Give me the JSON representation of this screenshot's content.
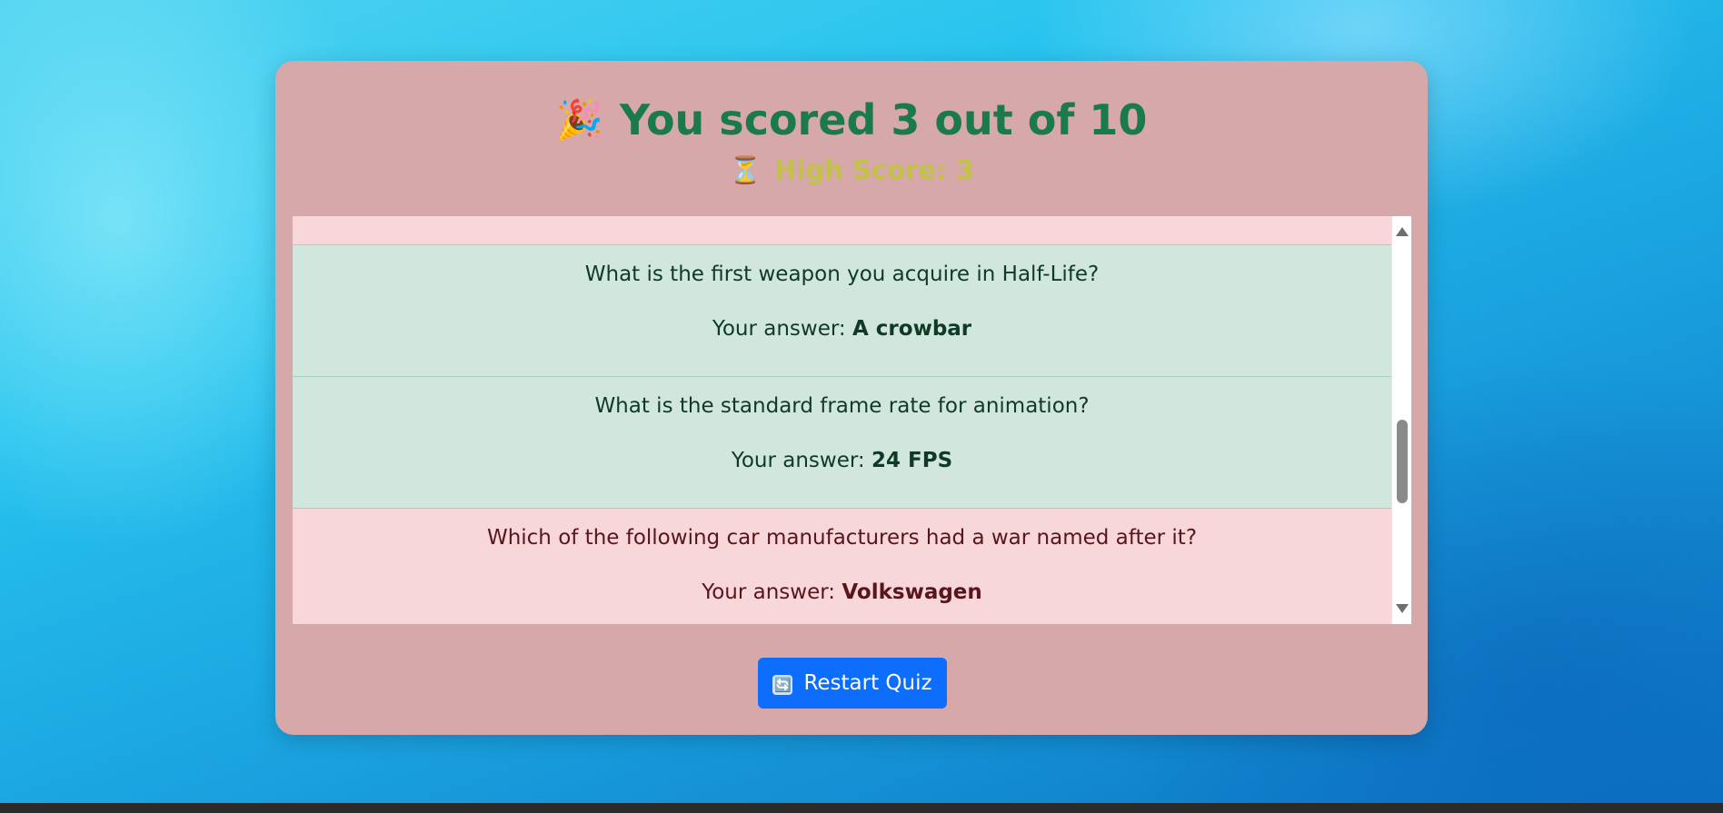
{
  "summary": {
    "title_emoji": "🎉",
    "title": "You scored 3 out of 10",
    "high_emoji": "⏳",
    "high_score": "High Score: 3"
  },
  "results": {
    "answer_prefix": "Your answer: ",
    "items": [
      {
        "status": "correct",
        "question": "What is the first weapon you acquire in Half-Life?",
        "answer": "A crowbar"
      },
      {
        "status": "correct",
        "question": "What is the standard frame rate for animation?",
        "answer": "24 FPS"
      },
      {
        "status": "wrong",
        "question": "Which of the following car manufacturers had a war named after it?",
        "answer": "Volkswagen"
      }
    ],
    "scroll_position_fraction": 0.62
  },
  "actions": {
    "restart_icon": "🔄",
    "restart_label": "Restart Quiz"
  },
  "colors": {
    "card": "#d6a8a9",
    "title": "#1b7a4c",
    "high_score": "#c2c14a",
    "correct_bg": "#d1e7dd",
    "wrong_bg": "#f8d7da",
    "button": "#0d6efd"
  }
}
